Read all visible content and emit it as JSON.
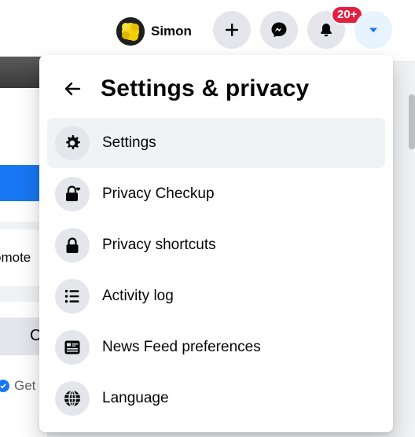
{
  "topbar": {
    "profile_name": "Simon",
    "notifications_badge": "20+",
    "buttons": [
      "create",
      "messenger",
      "notifications",
      "account"
    ]
  },
  "background": {
    "promote_text": "omote",
    "grey_button_text": "C",
    "get_text": "Get"
  },
  "panel": {
    "title": "Settings & privacy",
    "items": [
      {
        "label": "Settings",
        "icon": "gear-icon"
      },
      {
        "label": "Privacy Checkup",
        "icon": "lock-heart-icon"
      },
      {
        "label": "Privacy shortcuts",
        "icon": "lock-icon"
      },
      {
        "label": "Activity log",
        "icon": "list-icon"
      },
      {
        "label": "News Feed preferences",
        "icon": "news-feed-icon"
      },
      {
        "label": "Language",
        "icon": "globe-icon"
      }
    ]
  },
  "colors": {
    "accent": "#1877f2",
    "badge": "#e41e3f",
    "icon_bg": "#e4e6eb"
  }
}
